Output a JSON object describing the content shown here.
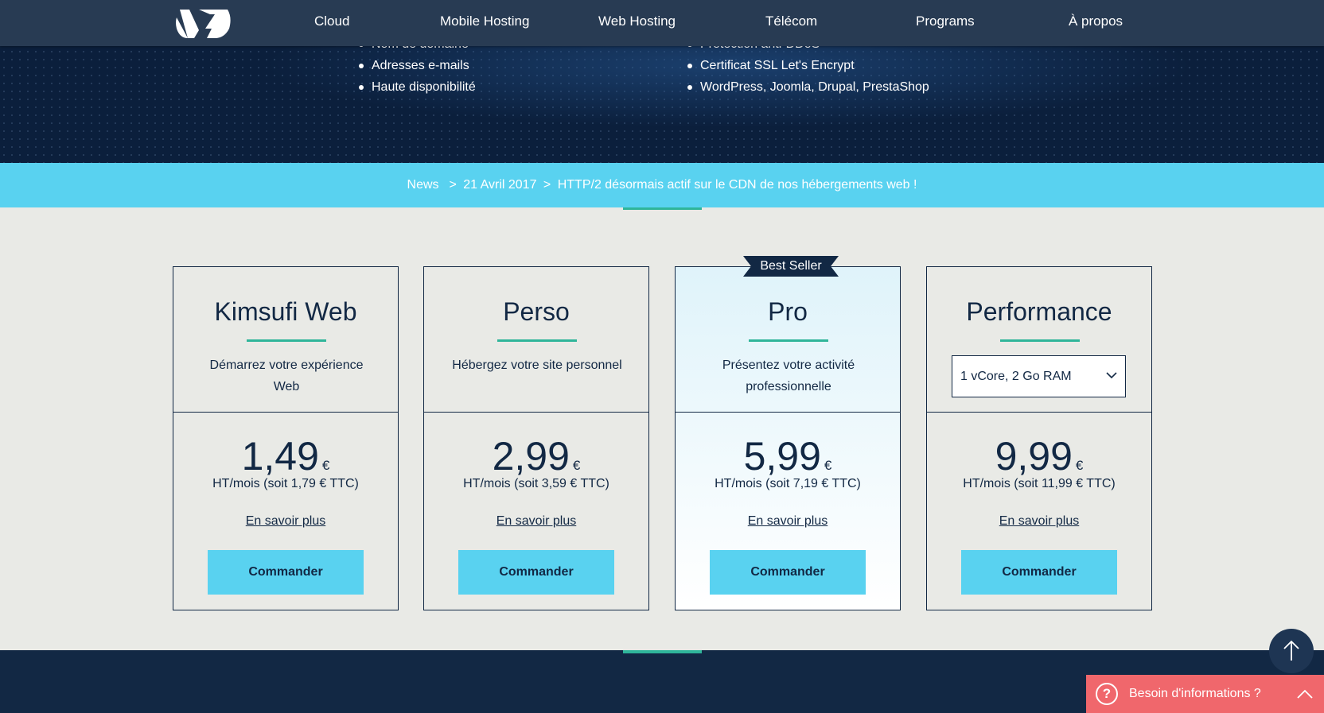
{
  "nav": {
    "items": [
      "Cloud",
      "Mobile Hosting",
      "Web Hosting",
      "Télécom",
      "Programs",
      "À propos"
    ]
  },
  "hero": {
    "left_list": [
      "Nom de domaine",
      "Adresses e-mails",
      "Haute disponibilité"
    ],
    "right_list": [
      "Protection anti-DDoS",
      "Certificat SSL Let's Encrypt",
      "WordPress, Joomla, Drupal, PrestaShop"
    ]
  },
  "news": {
    "label": "News",
    "date": "21 Avril 2017",
    "headline": "HTTP/2 désormais actif sur le CDN de nos hébergements web !"
  },
  "plans": [
    {
      "name": "Kimsufi Web",
      "description": "Démarrez votre expérience Web",
      "price": "1,49",
      "currency": "€",
      "price_note": "HT/mois (soit 1,79 € TTC)",
      "more_link": "En savoir plus",
      "order_label": "Commander"
    },
    {
      "name": "Perso",
      "description": "Hébergez votre site personnel",
      "price": "2,99",
      "currency": "€",
      "price_note": "HT/mois (soit 3,59 € TTC)",
      "more_link": "En savoir plus",
      "order_label": "Commander"
    },
    {
      "name": "Pro",
      "badge": "Best Seller",
      "description": "Présentez votre activité professionnelle",
      "price": "5,99",
      "currency": "€",
      "price_note": "HT/mois (soit 7,19 € TTC)",
      "more_link": "En savoir plus",
      "order_label": "Commander"
    },
    {
      "name": "Performance",
      "select_value": "1 vCore, 2 Go RAM",
      "price": "9,99",
      "currency": "€",
      "price_note": "HT/mois (soit 11,99 € TTC)",
      "more_link": "En savoir plus",
      "order_label": "Commander"
    }
  ],
  "help": {
    "label": "Besoin d'informations ?",
    "icon": "question-icon"
  },
  "colors": {
    "navy": "#122844",
    "nav_bg": "#283b53",
    "accent_blue": "#59d2f0",
    "accent_green": "#2fb59a",
    "help_red": "#f0676c",
    "page_bg": "#e9eae6"
  }
}
